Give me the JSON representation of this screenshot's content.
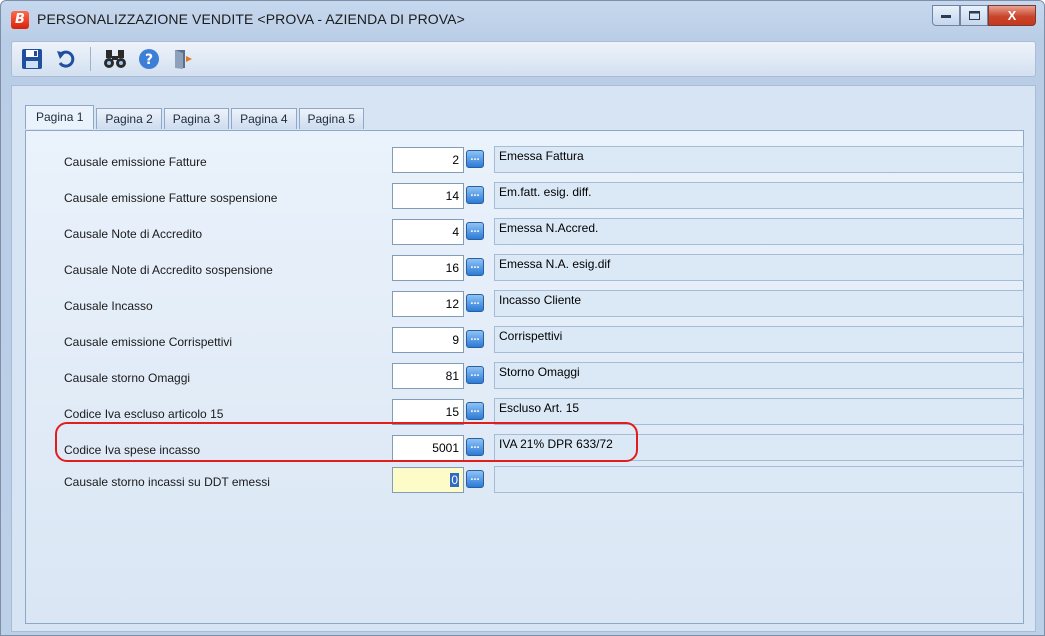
{
  "window": {
    "title": "PERSONALIZZAZIONE VENDITE <PROVA - AZIENDA DI PROVA>",
    "app_icon_letter": "B",
    "close_glyph": "X"
  },
  "toolbar": {
    "icons": [
      "save-icon",
      "undo-icon",
      "binoculars-icon",
      "help-icon",
      "exit-icon"
    ]
  },
  "tabs": [
    {
      "label": "Pagina 1",
      "active": true
    },
    {
      "label": "Pagina 2",
      "active": false
    },
    {
      "label": "Pagina 3",
      "active": false
    },
    {
      "label": "Pagina 4",
      "active": false
    },
    {
      "label": "Pagina 5",
      "active": false
    }
  ],
  "rows": [
    {
      "label": "Causale emissione Fatture",
      "code": "2",
      "desc": "Emessa Fattura"
    },
    {
      "label": "Causale emissione Fatture sospensione",
      "code": "14",
      "desc": "Em.fatt. esig. diff."
    },
    {
      "label": "Causale Note di Accredito",
      "code": "4",
      "desc": "Emessa N.Accred."
    },
    {
      "label": "Causale Note di Accredito sospensione",
      "code": "16",
      "desc": "Emessa N.A. esig.dif"
    },
    {
      "label": "Causale Incasso",
      "code": "12",
      "desc": "Incasso Cliente"
    },
    {
      "label": "Causale emissione Corrispettivi",
      "code": "9",
      "desc": "Corrispettivi"
    },
    {
      "label": "Causale storno Omaggi",
      "code": "81",
      "desc": "Storno Omaggi"
    },
    {
      "label": "Codice Iva escluso articolo 15",
      "code": "15",
      "desc": "Escluso Art. 15"
    },
    {
      "label": "Codice Iva spese incasso",
      "code": "5001",
      "desc": "IVA 21% DPR 633/72"
    },
    {
      "label": "Causale storno incassi su DDT emessi",
      "code": "0",
      "desc": ""
    }
  ],
  "lookup_glyph": "...",
  "colors": {
    "highlight": "#e01e1e",
    "active_field": "#fdfbc8"
  }
}
